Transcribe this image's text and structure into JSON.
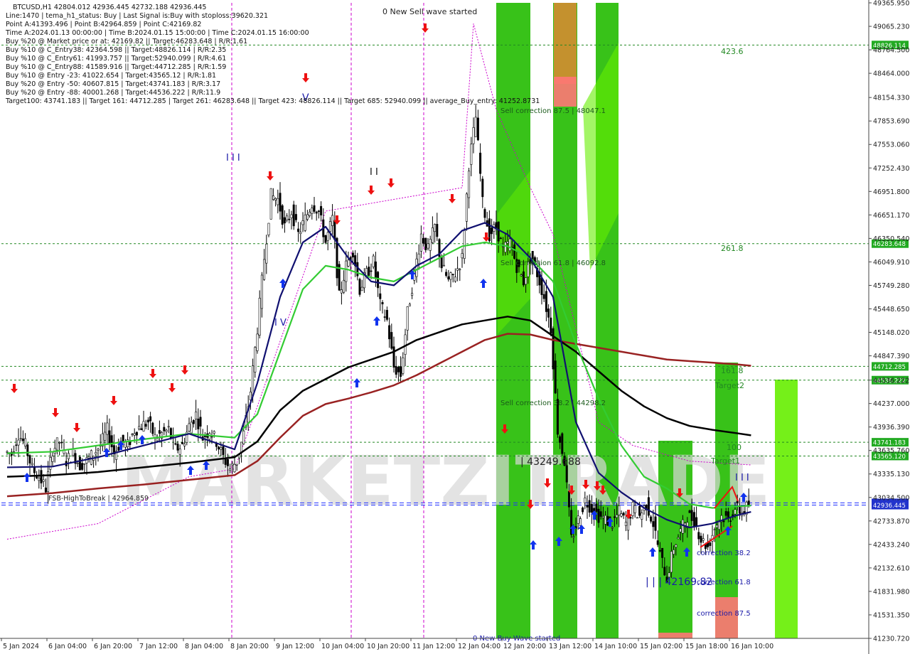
{
  "window": {
    "symbol_title": "BTCUSD,H1"
  },
  "info_lines": [
    "BTCUSD,H1  42804.012 42936.445 42732.188 42936.445",
    "Line:1470 | tema_h1_status: Buy | Last Signal is:Buy with stoploss:39620.321",
    "Point A:41393.496 | Point B:42964.859 | Point C:42169.82",
    "Time A:2024.01.13 00:00:00 | Time B:2024.01.15 15:00:00 | Time C:2024.01.15 16:00:00",
    "Buy %20 @ Market price or at: 42169.82 || Target:46283.648 | R/R:1.61",
    "Buy %10 @ C_Entry38: 42364.598 || Target:48826.114 | R/R:2.35",
    "Buy %10 @ C_Entry61: 41993.757 || Target:52940.099 | R/R:4.61",
    "Buy %10 @ C_Entry88: 41589.916 || Target:44712.285 | R/R:1.59",
    "Buy %10 @ Entry -23: 41022.654 | Target:43565.12 | R/R:1.81",
    "Buy %20 @ Entry -50: 40607.815 | Target:43741.183 | R/R:3.17",
    "Buy %20 @ Entry -88: 40001.268 | Target:44536.222 | R/R:11.9",
    "Target100: 43741.183 || Target 161: 44712.285 | Target 261: 46283.648 || Target 423: 48826.114 || Target 685: 52940.099 || average_Buy_entry: 41252.8731"
  ],
  "labels": {
    "wave_top": "0 New Sell wave started",
    "wave_bottom": "0 New Buy Wave started",
    "sell_corr_875": "Sell correction 87.5 | 48047.1",
    "sell_corr_618": "Sell correction 61.8 | 46092.8",
    "sell_corr_382": "Sell correction 38.2 | 44298.2",
    "point_b_label": "| 43249.688",
    "point_c_label": "| | | 42169.82",
    "corr_382": "correction 38.2",
    "corr_618": "correction 61.8",
    "corr_875": "correction 87.5",
    "fsb": "FSB-HighToBreak | 42964.859",
    "lvl_4236": "423.6",
    "lvl_2618": "261.8",
    "lvl_1618": "161.8",
    "lvl_100": "100",
    "target1": "Target1",
    "target2": "Target2",
    "wave_i": "I I I",
    "wave_v": "V",
    "wave_iv": "I V",
    "wave_ii": "I I",
    "wave_iii_b": "I I I"
  },
  "colors": {
    "price_line": "#2030ff",
    "bull_candle": "#000000",
    "green_zone": "#22bb00",
    "lime_zone": "#66ee00",
    "orange_zone": "#dd8833",
    "pink_zone": "#ff7777",
    "ma_navy": "#101070",
    "ma_green": "#33cc33",
    "ma_black": "#000000",
    "ma_maroon": "#992222",
    "level_green": "#228822",
    "magenta": "#cc00cc",
    "buy_arrow": "#1133ee",
    "sell_arrow": "#ee1111",
    "price_tag_green": "#22aa22",
    "price_tag_blue": "#2233cc"
  },
  "chart_data": {
    "type": "candlestick",
    "title": "BTCUSD,H1",
    "ylim": [
      41230.72,
      49365.95
    ],
    "y_ticks": [
      "49365.950",
      "49065.230",
      "48764.500",
      "48464.000",
      "48154.330",
      "47853.690",
      "47553.060",
      "47252.430",
      "46951.800",
      "46651.170",
      "46350.540",
      "46049.910",
      "45749.280",
      "45448.650",
      "45148.020",
      "44847.390",
      "44536.222",
      "44237.000",
      "43936.390",
      "43635.760",
      "43335.130",
      "43034.500",
      "42733.870",
      "42433.240",
      "42132.610",
      "41831.980",
      "41531.350",
      "41230.720"
    ],
    "x_ticks": [
      "5 Jan 2024",
      "6 Jan 04:00",
      "6 Jan 20:00",
      "7 Jan 12:00",
      "8 Jan 04:00",
      "8 Jan 20:00",
      "9 Jan 12:00",
      "10 Jan 04:00",
      "10 Jan 20:00",
      "11 Jan 12:00",
      "12 Jan 04:00",
      "12 Jan 20:00",
      "13 Jan 12:00",
      "14 Jan 10:00",
      "15 Jan 02:00",
      "15 Jan 18:00",
      "16 Jan 10:00"
    ],
    "levels": [
      {
        "price": 48826.114,
        "tag": "48826.114",
        "style": "green"
      },
      {
        "price": 46283.648,
        "tag": "46283.648",
        "style": "green"
      },
      {
        "price": 44712.285,
        "tag": "44712.285",
        "style": "green"
      },
      {
        "price": 44536.222,
        "tag": "44536.222",
        "style": "green"
      },
      {
        "price": 43741.183,
        "tag": "43741.183",
        "style": "green"
      },
      {
        "price": 43565.12,
        "tag": "43565.120",
        "style": "green"
      },
      {
        "price": 42964.859,
        "tag": "42964.859",
        "style": "blue"
      },
      {
        "price": 42936.445,
        "tag": "42936.445",
        "style": "current"
      }
    ],
    "close_path": [
      [
        0,
        43620
      ],
      [
        3,
        43590
      ],
      [
        6,
        43850
      ],
      [
        9,
        43700
      ],
      [
        12,
        43400
      ],
      [
        15,
        43300
      ],
      [
        18,
        43150
      ],
      [
        21,
        43650
      ],
      [
        24,
        43750
      ],
      [
        27,
        43500
      ],
      [
        30,
        43600
      ],
      [
        33,
        43450
      ],
      [
        36,
        43500
      ],
      [
        39,
        43600
      ],
      [
        42,
        43700
      ],
      [
        45,
        43900
      ],
      [
        48,
        43600
      ],
      [
        51,
        43750
      ],
      [
        54,
        43700
      ],
      [
        57,
        43900
      ],
      [
        60,
        43950
      ],
      [
        63,
        44000
      ],
      [
        66,
        43800
      ],
      [
        69,
        43850
      ],
      [
        72,
        43900
      ],
      [
        75,
        43650
      ],
      [
        78,
        43700
      ],
      [
        81,
        43950
      ],
      [
        84,
        44100
      ],
      [
        87,
        43800
      ],
      [
        90,
        43900
      ],
      [
        93,
        43750
      ],
      [
        96,
        43550
      ],
      [
        99,
        43400
      ],
      [
        102,
        43500
      ],
      [
        105,
        43850
      ],
      [
        108,
        44400
      ],
      [
        111,
        45200
      ],
      [
        114,
        46100
      ],
      [
        117,
        46900
      ],
      [
        120,
        46850
      ],
      [
        123,
        46500
      ],
      [
        126,
        46700
      ],
      [
        129,
        46400
      ],
      [
        132,
        46600
      ],
      [
        135,
        46800
      ],
      [
        138,
        46700
      ],
      [
        141,
        46300
      ],
      [
        144,
        46600
      ],
      [
        147,
        45600
      ],
      [
        150,
        46000
      ],
      [
        153,
        46200
      ],
      [
        156,
        45700
      ],
      [
        159,
        45900
      ],
      [
        162,
        46050
      ],
      [
        165,
        45500
      ],
      [
        168,
        45300
      ],
      [
        171,
        44700
      ],
      [
        174,
        44600
      ],
      [
        177,
        45400
      ],
      [
        180,
        45900
      ],
      [
        183,
        46400
      ],
      [
        186,
        46200
      ],
      [
        189,
        46500
      ],
      [
        192,
        46000
      ],
      [
        195,
        45800
      ],
      [
        198,
        45900
      ],
      [
        201,
        46100
      ],
      [
        204,
        47300
      ],
      [
        207,
        47900
      ],
      [
        210,
        46800
      ],
      [
        213,
        46400
      ],
      [
        216,
        46500
      ],
      [
        219,
        46200
      ],
      [
        222,
        46300
      ],
      [
        225,
        46000
      ],
      [
        228,
        45800
      ],
      [
        231,
        46100
      ],
      [
        234,
        45900
      ],
      [
        237,
        45600
      ],
      [
        240,
        45200
      ],
      [
        243,
        43900
      ],
      [
        246,
        43500
      ],
      [
        249,
        42500
      ],
      [
        252,
        42750
      ],
      [
        255,
        43000
      ],
      [
        258,
        42900
      ],
      [
        261,
        42800
      ],
      [
        264,
        42750
      ],
      [
        267,
        42700
      ],
      [
        270,
        42850
      ],
      [
        273,
        42700
      ],
      [
        276,
        42900
      ],
      [
        279,
        42800
      ],
      [
        282,
        42950
      ],
      [
        285,
        42700
      ],
      [
        288,
        42300
      ],
      [
        291,
        42000
      ],
      [
        294,
        42400
      ],
      [
        297,
        42600
      ],
      [
        300,
        42800
      ],
      [
        303,
        42750
      ],
      [
        306,
        42500
      ],
      [
        309,
        42400
      ],
      [
        312,
        42650
      ],
      [
        315,
        42800
      ],
      [
        318,
        42750
      ],
      [
        321,
        42900
      ],
      [
        324,
        42850
      ],
      [
        327,
        42936
      ]
    ],
    "ma_navy": [
      [
        0,
        43420
      ],
      [
        20,
        43430
      ],
      [
        40,
        43550
      ],
      [
        60,
        43700
      ],
      [
        80,
        43850
      ],
      [
        100,
        43650
      ],
      [
        110,
        44500
      ],
      [
        120,
        45600
      ],
      [
        130,
        46300
      ],
      [
        140,
        46500
      ],
      [
        150,
        46100
      ],
      [
        160,
        45800
      ],
      [
        170,
        45750
      ],
      [
        180,
        46000
      ],
      [
        190,
        46150
      ],
      [
        200,
        46450
      ],
      [
        210,
        46550
      ],
      [
        220,
        46400
      ],
      [
        230,
        46100
      ],
      [
        240,
        45600
      ],
      [
        250,
        44000
      ],
      [
        260,
        43350
      ],
      [
        270,
        43100
      ],
      [
        280,
        42900
      ],
      [
        290,
        42750
      ],
      [
        300,
        42650
      ],
      [
        310,
        42700
      ],
      [
        320,
        42800
      ],
      [
        327,
        42850
      ]
    ],
    "ma_green": [
      [
        0,
        43600
      ],
      [
        20,
        43620
      ],
      [
        40,
        43700
      ],
      [
        60,
        43780
      ],
      [
        80,
        43850
      ],
      [
        100,
        43800
      ],
      [
        110,
        44100
      ],
      [
        120,
        44900
      ],
      [
        130,
        45700
      ],
      [
        140,
        46000
      ],
      [
        150,
        45950
      ],
      [
        160,
        45850
      ],
      [
        170,
        45800
      ],
      [
        180,
        45950
      ],
      [
        190,
        46100
      ],
      [
        200,
        46250
      ],
      [
        210,
        46300
      ],
      [
        220,
        46250
      ],
      [
        230,
        46100
      ],
      [
        240,
        45800
      ],
      [
        250,
        45000
      ],
      [
        260,
        44300
      ],
      [
        270,
        43700
      ],
      [
        280,
        43300
      ],
      [
        290,
        43150
      ],
      [
        300,
        42950
      ],
      [
        310,
        42900
      ],
      [
        320,
        42920
      ],
      [
        327,
        42930
      ]
    ],
    "ma_black": [
      [
        0,
        43300
      ],
      [
        20,
        43320
      ],
      [
        40,
        43360
      ],
      [
        60,
        43420
      ],
      [
        80,
        43480
      ],
      [
        100,
        43550
      ],
      [
        110,
        43750
      ],
      [
        120,
        44150
      ],
      [
        130,
        44400
      ],
      [
        140,
        44550
      ],
      [
        150,
        44700
      ],
      [
        160,
        44800
      ],
      [
        170,
        44900
      ],
      [
        180,
        45050
      ],
      [
        190,
        45150
      ],
      [
        200,
        45250
      ],
      [
        210,
        45300
      ],
      [
        220,
        45350
      ],
      [
        230,
        45300
      ],
      [
        240,
        45100
      ],
      [
        250,
        44900
      ],
      [
        260,
        44650
      ],
      [
        270,
        44400
      ],
      [
        280,
        44200
      ],
      [
        290,
        44050
      ],
      [
        300,
        43950
      ],
      [
        310,
        43900
      ],
      [
        320,
        43860
      ],
      [
        327,
        43830
      ]
    ],
    "ma_maroon": [
      [
        0,
        43050
      ],
      [
        20,
        43090
      ],
      [
        40,
        43150
      ],
      [
        60,
        43200
      ],
      [
        80,
        43260
      ],
      [
        100,
        43320
      ],
      [
        110,
        43500
      ],
      [
        120,
        43800
      ],
      [
        130,
        44080
      ],
      [
        140,
        44230
      ],
      [
        150,
        44300
      ],
      [
        160,
        44380
      ],
      [
        170,
        44470
      ],
      [
        180,
        44600
      ],
      [
        190,
        44750
      ],
      [
        200,
        44900
      ],
      [
        210,
        45050
      ],
      [
        220,
        45130
      ],
      [
        230,
        45120
      ],
      [
        240,
        45050
      ],
      [
        250,
        45000
      ],
      [
        260,
        44950
      ],
      [
        270,
        44900
      ],
      [
        280,
        44850
      ],
      [
        290,
        44800
      ],
      [
        300,
        44780
      ],
      [
        310,
        44760
      ],
      [
        320,
        44740
      ],
      [
        327,
        44720
      ]
    ]
  }
}
